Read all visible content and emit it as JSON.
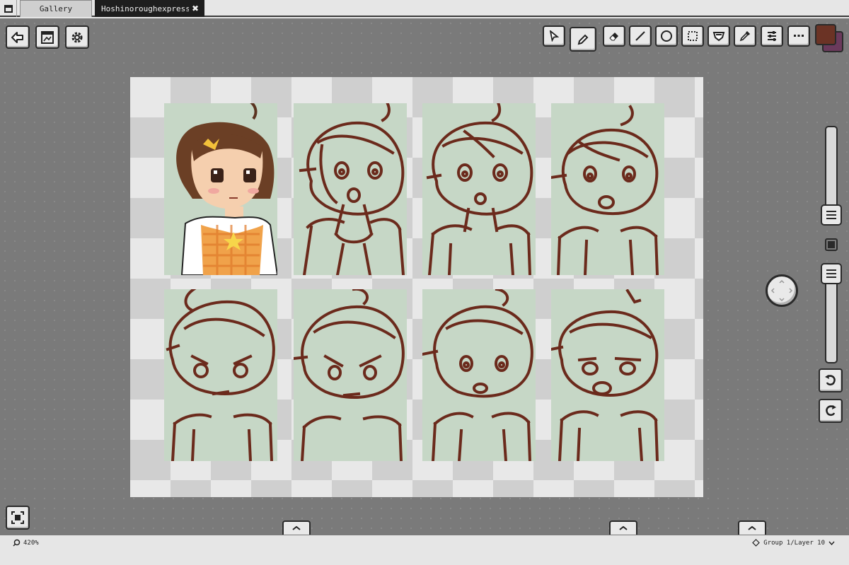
{
  "tabs": [
    {
      "label": "Gallery",
      "active": false
    },
    {
      "label": "Hoshinoroughexpress…",
      "active": true,
      "close": "✖"
    }
  ],
  "toolbar_left": [
    {
      "name": "back-button",
      "icon": "back-arrow-icon"
    },
    {
      "name": "export-button",
      "icon": "export-image-icon"
    },
    {
      "name": "settings-button",
      "icon": "gear-icon"
    }
  ],
  "toolbar_right": [
    {
      "name": "select-tool",
      "icon": "cursor-icon"
    },
    {
      "name": "pencil-tool",
      "icon": "pencil-icon",
      "active": true
    },
    {
      "name": "eraser-tool",
      "icon": "eraser-icon"
    },
    {
      "name": "line-tool",
      "icon": "line-icon"
    },
    {
      "name": "ellipse-tool",
      "icon": "circle-icon"
    },
    {
      "name": "selection-tool",
      "icon": "dashed-rect-icon"
    },
    {
      "name": "fill-tool",
      "icon": "bucket-icon"
    },
    {
      "name": "eyedropper-tool",
      "icon": "eyedropper-icon"
    },
    {
      "name": "adjust-tool",
      "icon": "sliders-icon"
    },
    {
      "name": "more-tool",
      "icon": "ellipsis-icon"
    }
  ],
  "colors": {
    "primary": "#6b3325",
    "secondary": "#6b3a5c",
    "sketch": "#6b2a1c",
    "panel": "#c6d7c6"
  },
  "status": {
    "zoom": "420%",
    "layer": "Group 1/Layer 10"
  }
}
